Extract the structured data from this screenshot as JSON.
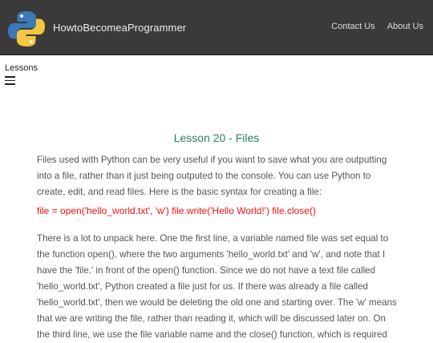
{
  "header": {
    "brand": "HowtoBecomeaProgrammer",
    "links": [
      "Contact Us",
      "About Us"
    ],
    "colors": {
      "bar": "#3a3a3a",
      "python_blue": "#3d78b8",
      "python_yellow": "#f5c63f"
    }
  },
  "sidebar": {
    "label": "Lessons",
    "menu_icon": "hamburger-menu-icon"
  },
  "content": {
    "title": "Lesson 20 - Files",
    "title_color": "#2e7d5b",
    "intro": "Files used with Python can be very useful if you want to save what you are outputting into a file, rather than it just being outputed to the console. You can use Python to create, edit, and read files. Here is the basic syntax for creating a file:",
    "code": "file = open('hello_world.txt', 'w') file.write('Hello World!') file.close()",
    "code_color": "#ee1111",
    "explanation": "There is a lot to unpack here. One the first line, a variable named file was set equal to the function open(), where the two arguments 'hello_world.txt' and 'w', and note that I have the 'file.' in front of the open() function. Since we do not have a text file called 'hello_world.txt', Python created a file just for us. If there was already a file called 'hello_world.txt', then we would be deleting the old one and starting over. The 'w' means that we are writing the file, rather than reading it, which will be discussed later on. On the third line, we use the file variable name and the close() function, which is required"
  }
}
